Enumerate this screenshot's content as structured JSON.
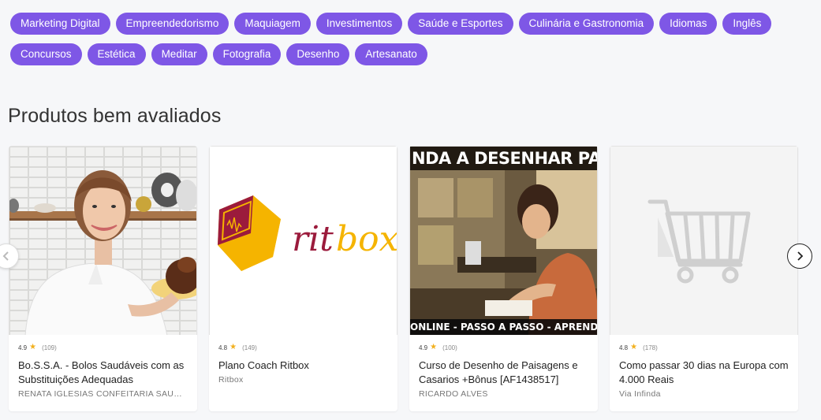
{
  "categories_row1": [
    "Marketing Digital",
    "Empreendedorismo",
    "Maquiagem",
    "Investimentos",
    "Saúde e Esportes",
    "Culinária e Gastronomia",
    "Idiomas",
    "Inglês"
  ],
  "categories_row2": [
    "Concursos",
    "Estética",
    "Meditar",
    "Fotografia",
    "Desenho",
    "Artesanato"
  ],
  "section_title": "Produtos bem avaliados",
  "products": [
    {
      "rating": "4.9",
      "count": "(109)",
      "title": "Bo.S.S.A. - Bolos Saudáveis com as Substituições Adequadas",
      "author": "RENATA IGLESIAS CONFEITARIA SAUDÁVEL"
    },
    {
      "rating": "4.8",
      "count": "(149)",
      "title": "Plano Coach Ritbox",
      "author": "Ritbox",
      "logo_part1": "rit",
      "logo_part2": "box"
    },
    {
      "rating": "4.9",
      "count": "(100)",
      "title": "Curso de Desenho de Paisagens e Casarios +Bônus [AF1438517]",
      "author": "RICARDO ALVES",
      "banner_top": "NDA A DESENHAR PAISA",
      "banner_bottom": "ONLINE - PASSO A PASSO - APRENDA"
    },
    {
      "rating": "4.8",
      "count": "(178)",
      "title": "Como passar 30 dias na Europa com 4.000 Reais",
      "author": "Via Infinda"
    }
  ],
  "colors": {
    "chip": "#7e57e6",
    "star": "#f2b01e",
    "ritbox_red": "#9b1b3c",
    "ritbox_yellow": "#f5b400"
  },
  "icons": {
    "star": "star-icon",
    "prev": "chevron-left-icon",
    "next": "chevron-right-icon",
    "placeholder": "shopping-cart-icon"
  }
}
